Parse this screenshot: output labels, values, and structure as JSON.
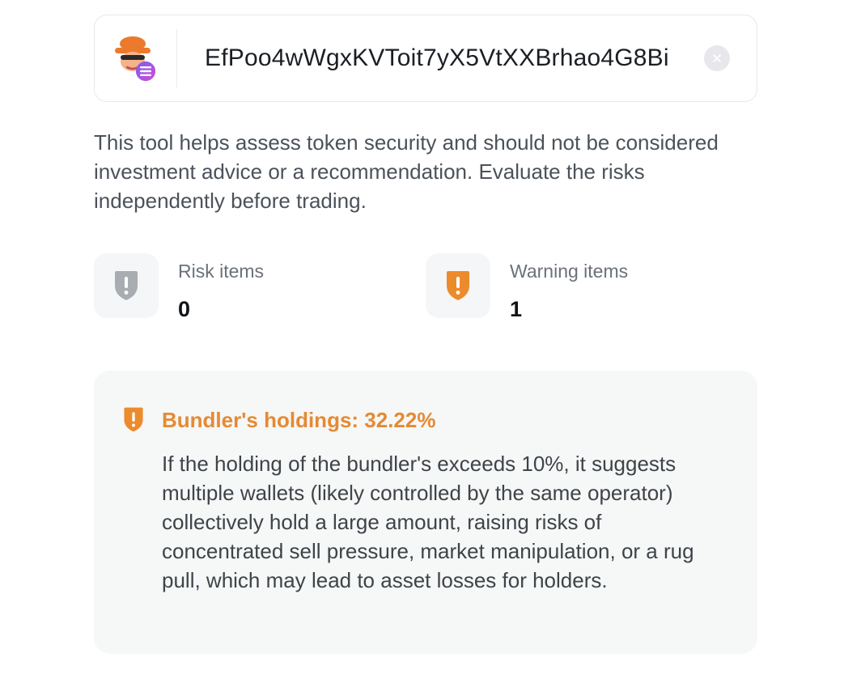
{
  "search": {
    "address": "EfPoo4wWgxKVToit7yX5VtXXBrhao4G8Bi",
    "logo_icon": "detective-mascot-with-solana-badge",
    "clear_icon": "close-icon"
  },
  "disclaimer": "This tool helps assess token security and should not be considered investment advice or a recommendation. Evaluate the risks independently before trading.",
  "stats": {
    "risk": {
      "label": "Risk items",
      "value": "0",
      "icon": "shield-exclamation-icon",
      "color": "#a9adb2"
    },
    "warning": {
      "label": "Warning items",
      "value": "1",
      "icon": "shield-exclamation-icon",
      "color": "#ec8b2c"
    }
  },
  "warning_card": {
    "title": "Bundler's holdings: 32.22%",
    "body": "If the holding of the bundler's exceeds 10%, it suggests multiple wallets (likely controlled by the same operator) collectively hold a large amount, raising risks of concentrated sell pressure, market manipulation, or a rug pull, which may lead to asset losses for holders.",
    "icon": "shield-exclamation-icon",
    "color": "#ec8b2c"
  }
}
